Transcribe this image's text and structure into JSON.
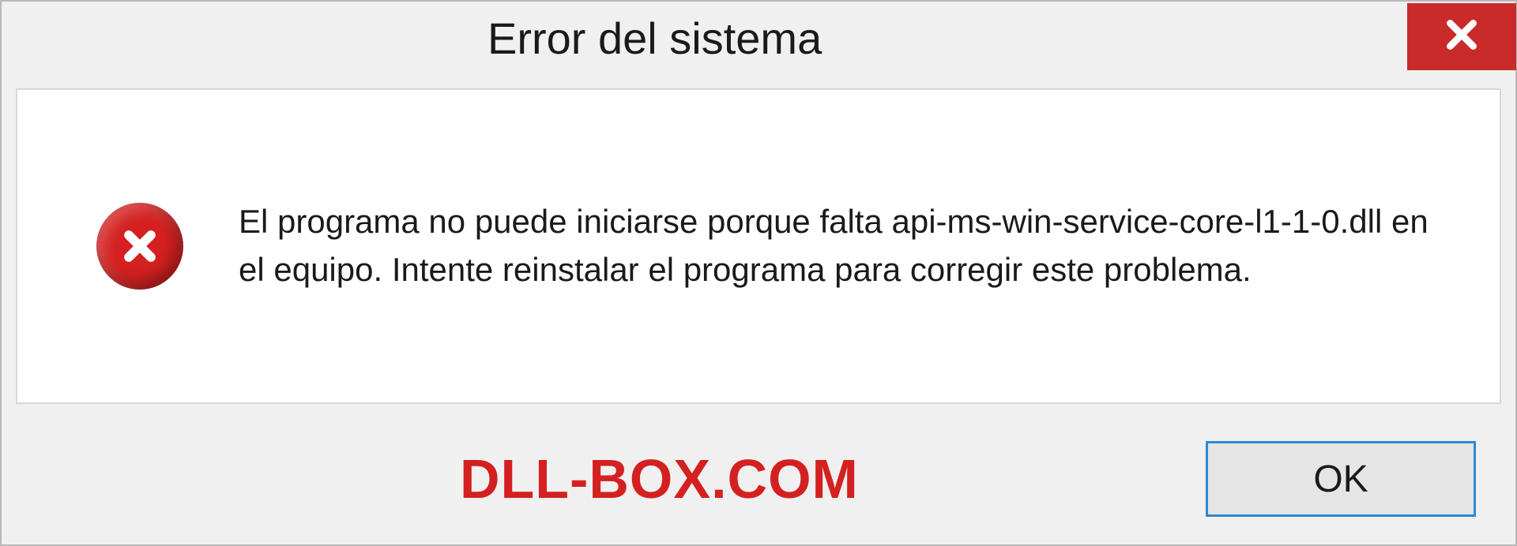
{
  "titlebar": {
    "title": "Error del sistema"
  },
  "content": {
    "message": "El programa no puede iniciarse porque falta api-ms-win-service-core-l1-1-0.dll en el equipo. Intente reinstalar el programa para corregir este problema."
  },
  "footer": {
    "watermark": "DLL-BOX.COM",
    "ok_label": "OK"
  },
  "icons": {
    "close": "close-icon",
    "error": "error-circle-x-icon"
  },
  "colors": {
    "close_bg": "#c92a2a",
    "error_bg": "#d42020",
    "watermark": "#d42020",
    "ok_border": "#2a8ad4",
    "panel_bg": "#ffffff",
    "dialog_bg": "#f0f0f0"
  }
}
